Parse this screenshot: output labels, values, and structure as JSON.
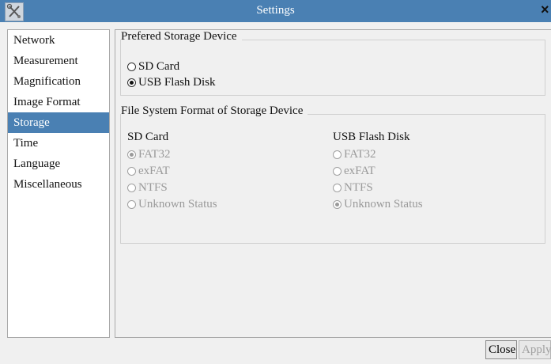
{
  "window": {
    "title": "Settings",
    "close_glyph": "×",
    "app_icon": "tools-icon"
  },
  "sidebar": {
    "items": [
      {
        "label": "Network",
        "selected": false
      },
      {
        "label": "Measurement",
        "selected": false
      },
      {
        "label": "Magnification",
        "selected": false
      },
      {
        "label": "Image Format",
        "selected": false
      },
      {
        "label": "Storage",
        "selected": true
      },
      {
        "label": "Time",
        "selected": false
      },
      {
        "label": "Language",
        "selected": false
      },
      {
        "label": "Miscellaneous",
        "selected": false
      }
    ]
  },
  "preferred": {
    "legend": "Prefered Storage Device",
    "options": [
      {
        "label": "SD Card",
        "checked": false
      },
      {
        "label": "USB Flash Disk",
        "checked": true
      }
    ]
  },
  "format": {
    "legend": "File System Format of Storage Device",
    "sd": {
      "heading": "SD Card",
      "options": [
        {
          "label": "FAT32",
          "checked": true
        },
        {
          "label": "exFAT",
          "checked": false
        },
        {
          "label": "NTFS",
          "checked": false
        },
        {
          "label": "Unknown Status",
          "checked": false
        }
      ]
    },
    "usb": {
      "heading": "USB Flash Disk",
      "options": [
        {
          "label": "FAT32",
          "checked": false
        },
        {
          "label": "exFAT",
          "checked": false
        },
        {
          "label": "NTFS",
          "checked": false
        },
        {
          "label": "Unknown Status",
          "checked": true
        }
      ]
    }
  },
  "buttons": {
    "close": "Close",
    "apply": "Apply"
  },
  "colors": {
    "accent": "#4a80b3",
    "disabled_text": "#9a9a9a"
  }
}
